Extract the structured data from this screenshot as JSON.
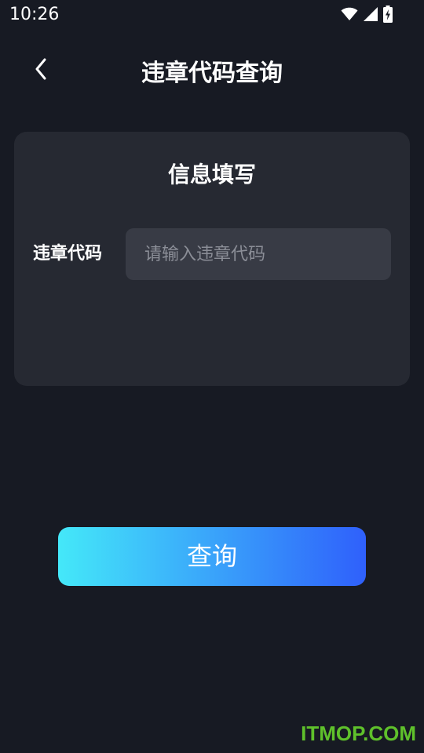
{
  "status_bar": {
    "time": "10:26",
    "icons": [
      "wifi-icon",
      "signal-icon",
      "battery-charging-icon"
    ]
  },
  "header": {
    "back_icon": "chevron-left-icon",
    "title": "违章代码查询"
  },
  "card": {
    "title": "信息填写",
    "field_label": "违章代码",
    "field_value": "",
    "field_placeholder": "请输入违章代码"
  },
  "submit": {
    "label": "查询"
  },
  "colors": {
    "background": "#171a23",
    "card": "#262932",
    "input": "#383b45",
    "button_gradient_start": "#44e8f9",
    "button_gradient_end": "#2f60fb"
  },
  "watermark": "ITMOP.COM"
}
